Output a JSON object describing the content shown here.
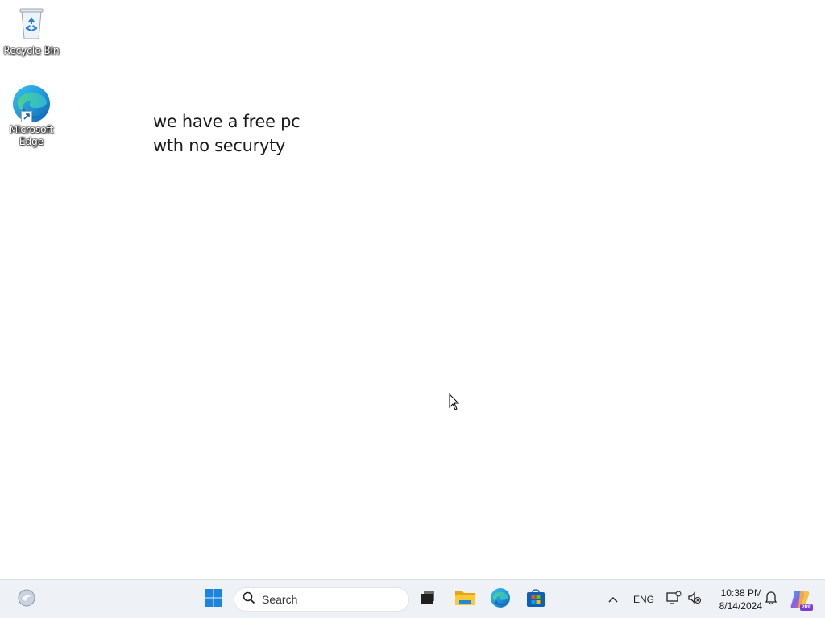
{
  "desktop": {
    "icons": [
      {
        "label": "Recycle Bin",
        "icon": "recycle-bin-icon"
      },
      {
        "label": "Microsoft Edge",
        "icon": "edge-icon"
      }
    ],
    "wallpaper_text": [
      "we have a free pc",
      "wth no securyty"
    ]
  },
  "taskbar": {
    "widgets_icon": "widgets-icon",
    "start_icon": "windows-start-icon",
    "search": {
      "placeholder": "Search",
      "icon": "search-icon"
    },
    "pinned": [
      {
        "name": "task-view",
        "icon": "task-view-icon"
      },
      {
        "name": "file-explorer",
        "icon": "folder-icon"
      },
      {
        "name": "microsoft-edge",
        "icon": "edge-icon"
      },
      {
        "name": "microsoft-store",
        "icon": "store-icon"
      }
    ],
    "tray": {
      "overflow_icon": "chevron-up-icon",
      "language": "ENG",
      "network_icon": "network-icon",
      "volume_icon": "volume-muted-icon",
      "time": "10:38 PM",
      "date": "8/14/2024",
      "notification_icon": "notification-icon",
      "copilot_icon": "copilot-icon",
      "copilot_badge": "PRE"
    }
  },
  "colors": {
    "taskbar_bg": "#eef1f5",
    "desktop_bg": "#ffffff",
    "windows_blue": "#0078d4"
  }
}
